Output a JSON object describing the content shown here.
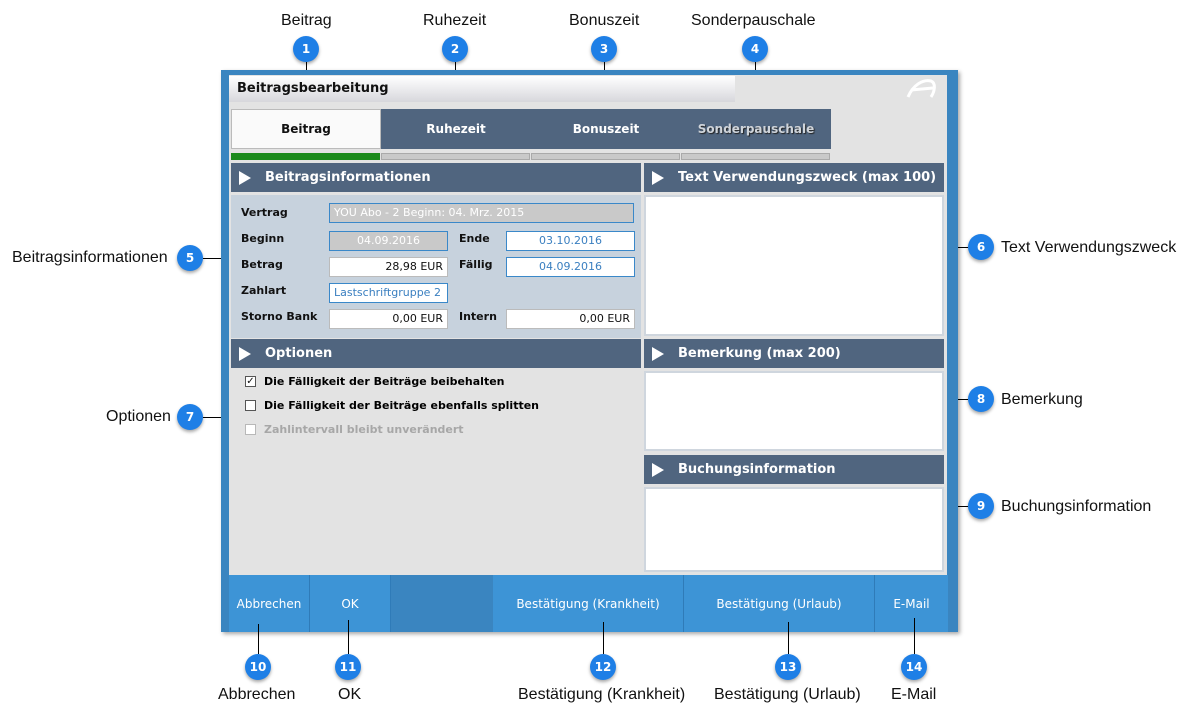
{
  "callouts": {
    "top": [
      {
        "num": "1",
        "label": "Beitrag"
      },
      {
        "num": "2",
        "label": "Ruhezeit"
      },
      {
        "num": "3",
        "label": "Bonuszeit"
      },
      {
        "num": "4",
        "label": "Sonderpauschale"
      }
    ],
    "left": [
      {
        "num": "5",
        "label": "Beitragsinformationen"
      },
      {
        "num": "7",
        "label": "Optionen"
      }
    ],
    "right": [
      {
        "num": "6",
        "label": "Text Verwendungszweck"
      },
      {
        "num": "8",
        "label": "Bemerkung"
      },
      {
        "num": "9",
        "label": "Buchungsinformation"
      }
    ],
    "bottom": [
      {
        "num": "10",
        "label": "Abbrechen"
      },
      {
        "num": "11",
        "label": "OK"
      },
      {
        "num": "12",
        "label": "Bestätigung (Krankheit)"
      },
      {
        "num": "13",
        "label": "Bestätigung (Urlaub)"
      },
      {
        "num": "14",
        "label": "E-Mail"
      }
    ]
  },
  "window": {
    "title": "Beitragsbearbeitung",
    "tabs": [
      {
        "label": "Beitrag",
        "state": "active"
      },
      {
        "label": "Ruhezeit",
        "state": "normal"
      },
      {
        "label": "Bonuszeit",
        "state": "normal"
      },
      {
        "label": "Sonderpauschale",
        "state": "disabled"
      }
    ],
    "sections": {
      "info": "Beitragsinformationen",
      "purpose": "Text Verwendungszweck (max 100)",
      "options": "Optionen",
      "remark": "Bemerkung (max 200)",
      "booking": "Buchungsinformation"
    },
    "fields": {
      "vertrag_label": "Vertrag",
      "vertrag_value": "YOU Abo - 2 Beginn: 04. Mrz. 2015",
      "beginn_label": "Beginn",
      "beginn_value": "04.09.2016",
      "ende_label": "Ende",
      "ende_value": "03.10.2016",
      "betrag_label": "Betrag",
      "betrag_value": "28,98 EUR",
      "faellig_label": "Fällig",
      "faellig_value": "04.09.2016",
      "zahlart_label": "Zahlart",
      "zahlart_value": "Lastschriftgruppe 2",
      "storno_label": "Storno Bank",
      "storno_value": "0,00 EUR",
      "intern_label": "Intern",
      "intern_value": "0,00 EUR"
    },
    "options": [
      {
        "label": "Die Fälligkeit der Beiträge beibehalten",
        "checked": true,
        "enabled": true
      },
      {
        "label": "Die Fälligkeit der Beiträge ebenfalls splitten",
        "checked": false,
        "enabled": true
      },
      {
        "label": "Zahlintervall bleibt unverändert",
        "checked": false,
        "enabled": false
      }
    ],
    "buttons": {
      "cancel": "Abbrechen",
      "ok": "OK",
      "sick": "Bestätigung (Krankheit)",
      "vacation": "Bestätigung (Urlaub)",
      "email": "E-Mail"
    }
  },
  "colors": {
    "accent": "#3d94d6",
    "callout": "#1e7fe6",
    "section_header": "#50657f",
    "progress_active": "#1b8a1b"
  }
}
